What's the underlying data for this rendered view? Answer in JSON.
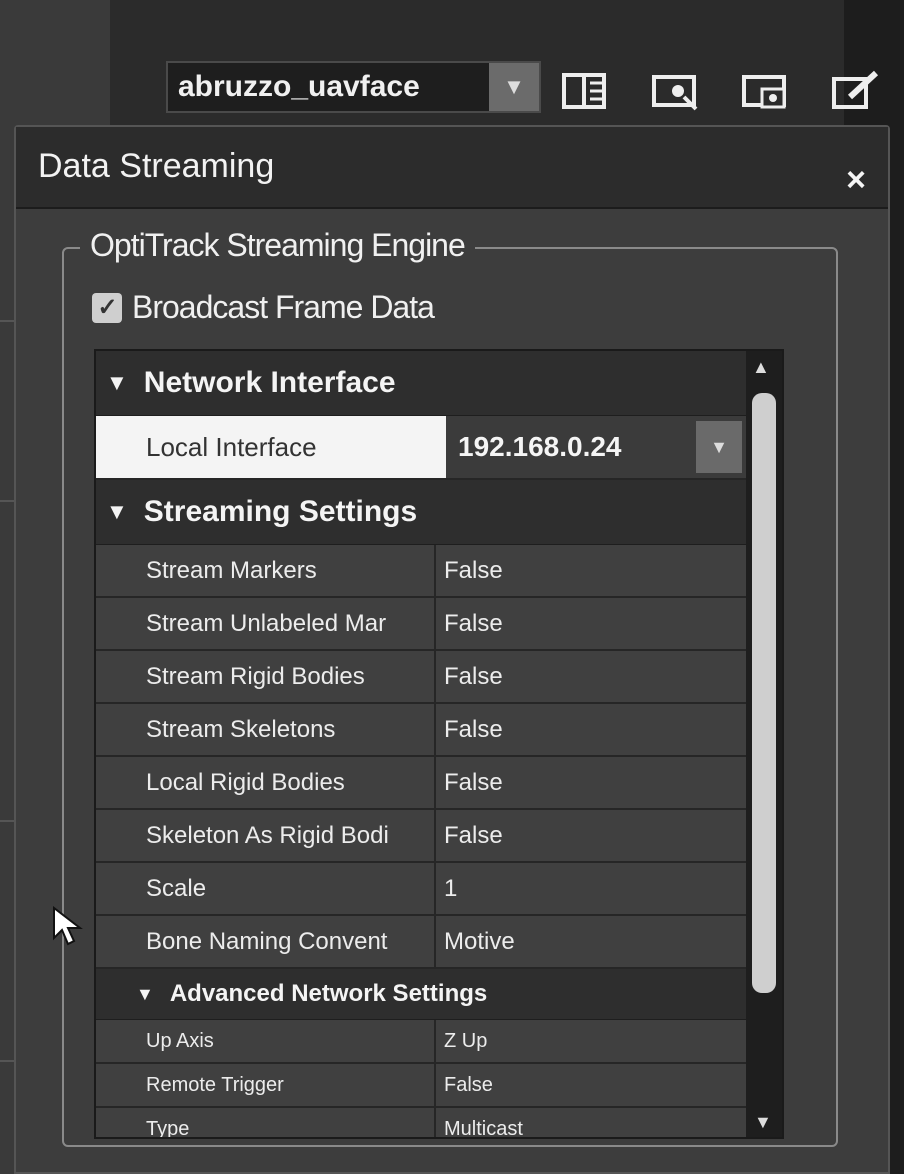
{
  "toolbar": {
    "profile_value": "abruzzo_uavface",
    "buttons": [
      {
        "icon": "layout-icon"
      },
      {
        "icon": "display-settings-icon"
      },
      {
        "icon": "capture-icon"
      },
      {
        "icon": "edit-icon"
      }
    ]
  },
  "panel": {
    "title": "Data Streaming",
    "close_label": "×",
    "group_title": "OptiTrack Streaming Engine",
    "broadcast_label": "Broadcast Frame Data",
    "broadcast_checked": true
  },
  "network_interface": {
    "section_label": "Network Interface",
    "local_interface_label": "Local Interface",
    "local_interface_value": "192.168.0.24"
  },
  "streaming_settings": {
    "section_label": "Streaming Settings",
    "rows": [
      {
        "name": "Stream Markers",
        "value": "False"
      },
      {
        "name": "Stream Unlabeled Mar",
        "value": "False"
      },
      {
        "name": "Stream Rigid Bodies",
        "value": "False"
      },
      {
        "name": "Stream Skeletons",
        "value": "False"
      },
      {
        "name": "Local Rigid Bodies",
        "value": "False"
      },
      {
        "name": "Skeleton As Rigid Bodi",
        "value": "False"
      },
      {
        "name": "Scale",
        "value": "1"
      },
      {
        "name": "Bone Naming Convent",
        "value": "Motive"
      }
    ]
  },
  "advanced_network": {
    "section_label": "Advanced Network Settings",
    "rows": [
      {
        "name": "Up Axis",
        "value": "Z Up"
      },
      {
        "name": "Remote Trigger",
        "value": "False"
      },
      {
        "name": "Type",
        "value": "Multicast"
      }
    ]
  },
  "colors": {
    "panel_bg": "#3d3d3d",
    "header_bg": "#2c2c2c",
    "selected_row_bg": "#f4f4f4"
  }
}
